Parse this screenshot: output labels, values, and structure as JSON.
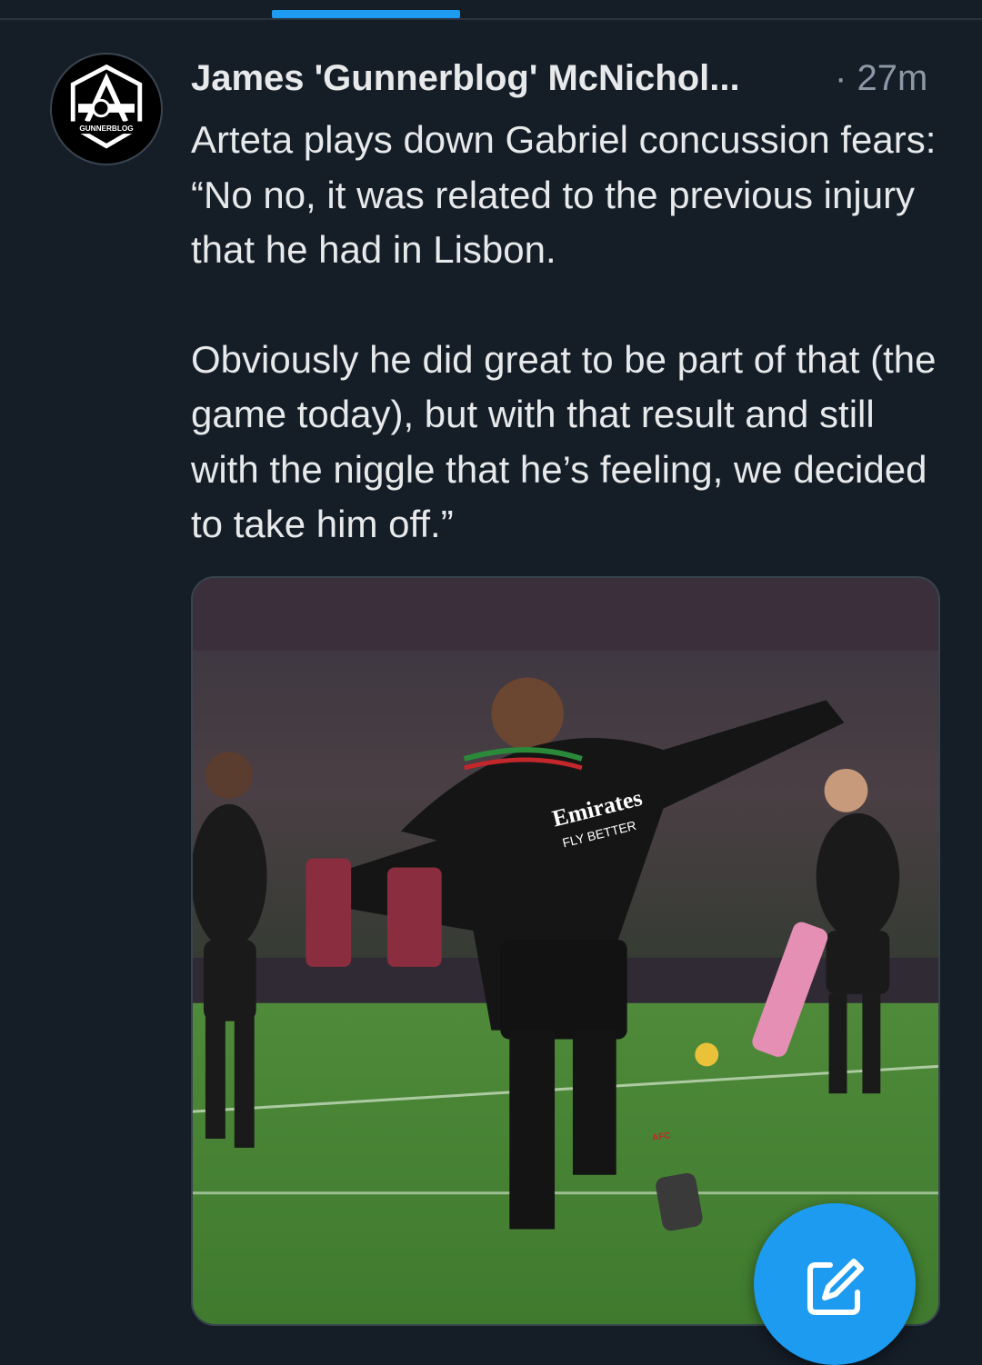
{
  "post": {
    "author_name": "James 'Gunnerblog' McNichol...",
    "separator": "·",
    "timestamp": "27m",
    "avatar_label": "GUNNERBLOG",
    "text_paragraphs": [
      "Arteta plays down Gabriel concussion fears: “No no, it was related to the previous injury that he had in Lisbon.",
      "Obviously he did great to be part of that (the game today), but with that result and still with the niggle that he’s feeling, we decided to take him off.”"
    ],
    "media": {
      "shirt_sponsor": "Emirates",
      "shirt_slogan": "FLY BETTER",
      "shorts_text": "AFC"
    }
  },
  "compose_button": {
    "icon": "compose-icon"
  },
  "colors": {
    "background": "#151d27",
    "accent": "#1d9bf0",
    "text_primary": "#e7e9ea",
    "text_secondary": "#8b98a5"
  }
}
